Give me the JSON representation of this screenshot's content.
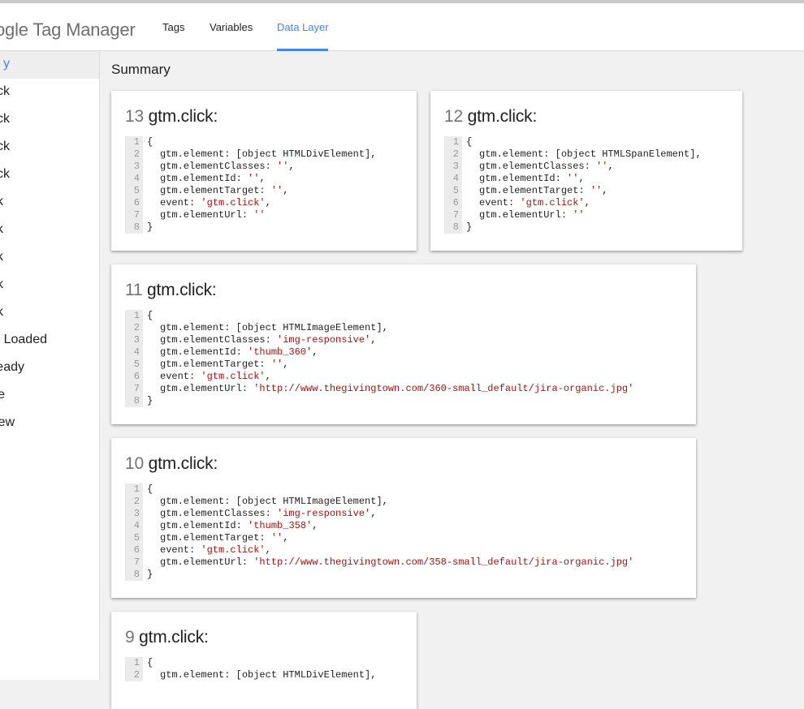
{
  "app": {
    "logo_text": "ogle Tag Manager"
  },
  "tabs": [
    {
      "label": "Tags"
    },
    {
      "label": "Variables"
    },
    {
      "label": "Data Layer"
    }
  ],
  "sidebar": {
    "items": [
      {
        "label": "y"
      },
      {
        "label": "ck"
      },
      {
        "label": "ck"
      },
      {
        "label": "ck"
      },
      {
        "label": "ck"
      },
      {
        "label": "k"
      },
      {
        "label": "k"
      },
      {
        "label": "k"
      },
      {
        "label": "k"
      },
      {
        "label": "k"
      },
      {
        "label": "Loaded"
      },
      {
        "label": "eady"
      },
      {
        "label": "e"
      },
      {
        "label": "ew"
      }
    ]
  },
  "main": {
    "title": "Summary",
    "events": [
      {
        "number": "13",
        "name": "gtm.click:",
        "lines": [
          {
            "n": "1",
            "t": [
              {
                "s": "{"
              }
            ]
          },
          {
            "n": "2",
            "t": [
              {
                "s": "gtm.element: [object HTMLDivElement],"
              }
            ]
          },
          {
            "n": "3",
            "t": [
              {
                "s": "gtm.elementClasses: "
              },
              {
                "s": "''",
                "str": true
              },
              {
                "s": ","
              }
            ]
          },
          {
            "n": "4",
            "t": [
              {
                "s": "gtm.elementId: "
              },
              {
                "s": "''",
                "str": true
              },
              {
                "s": ","
              }
            ]
          },
          {
            "n": "5",
            "t": [
              {
                "s": "gtm.elementTarget: "
              },
              {
                "s": "''",
                "str": true
              },
              {
                "s": ","
              }
            ]
          },
          {
            "n": "6",
            "t": [
              {
                "s": "event: "
              },
              {
                "s": "'gtm.click'",
                "str": true
              },
              {
                "s": ","
              }
            ]
          },
          {
            "n": "7",
            "t": [
              {
                "s": "gtm.elementUrl: "
              },
              {
                "s": "''",
                "str": true
              }
            ]
          },
          {
            "n": "8",
            "t": [
              {
                "s": "}"
              }
            ]
          }
        ]
      },
      {
        "number": "12",
        "name": "gtm.click:",
        "lines": [
          {
            "n": "1",
            "t": [
              {
                "s": "{"
              }
            ]
          },
          {
            "n": "2",
            "t": [
              {
                "s": "gtm.element: [object HTMLSpanElement],"
              }
            ]
          },
          {
            "n": "3",
            "t": [
              {
                "s": "gtm.elementClasses: "
              },
              {
                "s": "''",
                "str": true
              },
              {
                "s": ","
              }
            ]
          },
          {
            "n": "4",
            "t": [
              {
                "s": "gtm.elementId: "
              },
              {
                "s": "''",
                "str": true
              },
              {
                "s": ","
              }
            ]
          },
          {
            "n": "5",
            "t": [
              {
                "s": "gtm.elementTarget: "
              },
              {
                "s": "''",
                "str": true
              },
              {
                "s": ","
              }
            ]
          },
          {
            "n": "6",
            "t": [
              {
                "s": "event: "
              },
              {
                "s": "'gtm.click'",
                "str": true
              },
              {
                "s": ","
              }
            ]
          },
          {
            "n": "7",
            "t": [
              {
                "s": "gtm.elementUrl: "
              },
              {
                "s": "''",
                "str": true
              }
            ]
          },
          {
            "n": "8",
            "t": [
              {
                "s": "}"
              }
            ]
          }
        ]
      },
      {
        "number": "11",
        "name": "gtm.click:",
        "lines": [
          {
            "n": "1",
            "t": [
              {
                "s": "{"
              }
            ]
          },
          {
            "n": "2",
            "t": [
              {
                "s": "gtm.element: [object HTMLImageElement],"
              }
            ]
          },
          {
            "n": "3",
            "t": [
              {
                "s": "gtm.elementClasses: "
              },
              {
                "s": "'img-responsive'",
                "str": true
              },
              {
                "s": ","
              }
            ]
          },
          {
            "n": "4",
            "t": [
              {
                "s": "gtm.elementId: "
              },
              {
                "s": "'thumb_360'",
                "str": true
              },
              {
                "s": ","
              }
            ]
          },
          {
            "n": "5",
            "t": [
              {
                "s": "gtm.elementTarget: "
              },
              {
                "s": "''",
                "str": true
              },
              {
                "s": ","
              }
            ]
          },
          {
            "n": "6",
            "t": [
              {
                "s": "event: "
              },
              {
                "s": "'gtm.click'",
                "str": true
              },
              {
                "s": ","
              }
            ]
          },
          {
            "n": "7",
            "t": [
              {
                "s": "gtm.elementUrl: "
              },
              {
                "s": "'http://www.thegivingtown.com/360-small_default/jira-organic.jpg'",
                "str": true
              }
            ]
          },
          {
            "n": "8",
            "t": [
              {
                "s": "}"
              }
            ]
          }
        ]
      },
      {
        "number": "10",
        "name": "gtm.click:",
        "lines": [
          {
            "n": "1",
            "t": [
              {
                "s": "{"
              }
            ]
          },
          {
            "n": "2",
            "t": [
              {
                "s": "gtm.element: [object HTMLImageElement],"
              }
            ]
          },
          {
            "n": "3",
            "t": [
              {
                "s": "gtm.elementClasses: "
              },
              {
                "s": "'img-responsive'",
                "str": true
              },
              {
                "s": ","
              }
            ]
          },
          {
            "n": "4",
            "t": [
              {
                "s": "gtm.elementId: "
              },
              {
                "s": "'thumb_358'",
                "str": true
              },
              {
                "s": ","
              }
            ]
          },
          {
            "n": "5",
            "t": [
              {
                "s": "gtm.elementTarget: "
              },
              {
                "s": "''",
                "str": true
              },
              {
                "s": ","
              }
            ]
          },
          {
            "n": "6",
            "t": [
              {
                "s": "event: "
              },
              {
                "s": "'gtm.click'",
                "str": true
              },
              {
                "s": ","
              }
            ]
          },
          {
            "n": "7",
            "t": [
              {
                "s": "gtm.elementUrl: "
              },
              {
                "s": "'http://www.thegivingtown.com/358-small_default/jira-organic.jpg'",
                "str": true
              }
            ]
          },
          {
            "n": "8",
            "t": [
              {
                "s": "}"
              }
            ]
          }
        ]
      },
      {
        "number": "9",
        "name": "gtm.click:",
        "lines": [
          {
            "n": "1",
            "t": [
              {
                "s": "{"
              }
            ]
          },
          {
            "n": "2",
            "t": [
              {
                "s": "gtm.element: [object HTMLDivElement],"
              }
            ]
          }
        ]
      }
    ]
  }
}
